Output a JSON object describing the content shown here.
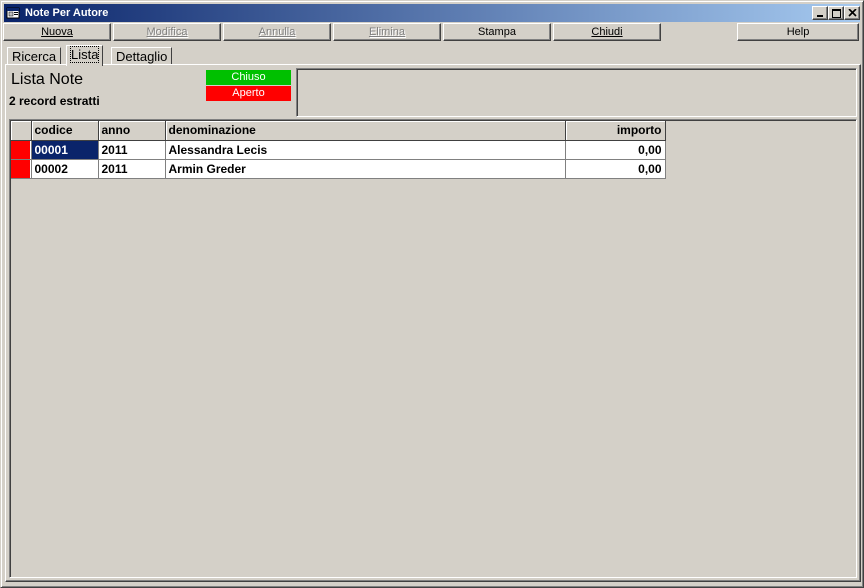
{
  "window": {
    "title": "Note Per Autore"
  },
  "toolbar": {
    "nuova": "Nuova",
    "modifica": "Modifica",
    "annulla": "Annulla",
    "elimina": "Elimina",
    "stampa": "Stampa",
    "chiudi": "Chiudi",
    "help": "Help"
  },
  "tabs": [
    {
      "label": "Ricerca",
      "active": false
    },
    {
      "label": "Lista",
      "active": true
    },
    {
      "label": "Dettaglio",
      "active": false
    }
  ],
  "list": {
    "title": "Lista Note",
    "record_count": "2 record estratti"
  },
  "legend": {
    "closed_label": "Chiuso",
    "closed_color": "#00c000",
    "open_label": "Aperto",
    "open_color": "#ff0000"
  },
  "table": {
    "columns": [
      "codice",
      "anno",
      "denominazione",
      "importo"
    ],
    "rows": [
      {
        "codice": "00001",
        "anno": "2011",
        "denominazione": "Alessandra Lecis",
        "importo": "0,00",
        "status": "Aperto",
        "selected": true
      },
      {
        "codice": "00002",
        "anno": "2011",
        "denominazione": "Armin Greder",
        "importo": "0,00",
        "status": "Aperto",
        "selected": false
      }
    ]
  },
  "colors": {
    "titlebar_start": "#0a246a",
    "titlebar_end": "#a6caf0",
    "selection": "#0a246a",
    "face": "#d4d0c8"
  }
}
